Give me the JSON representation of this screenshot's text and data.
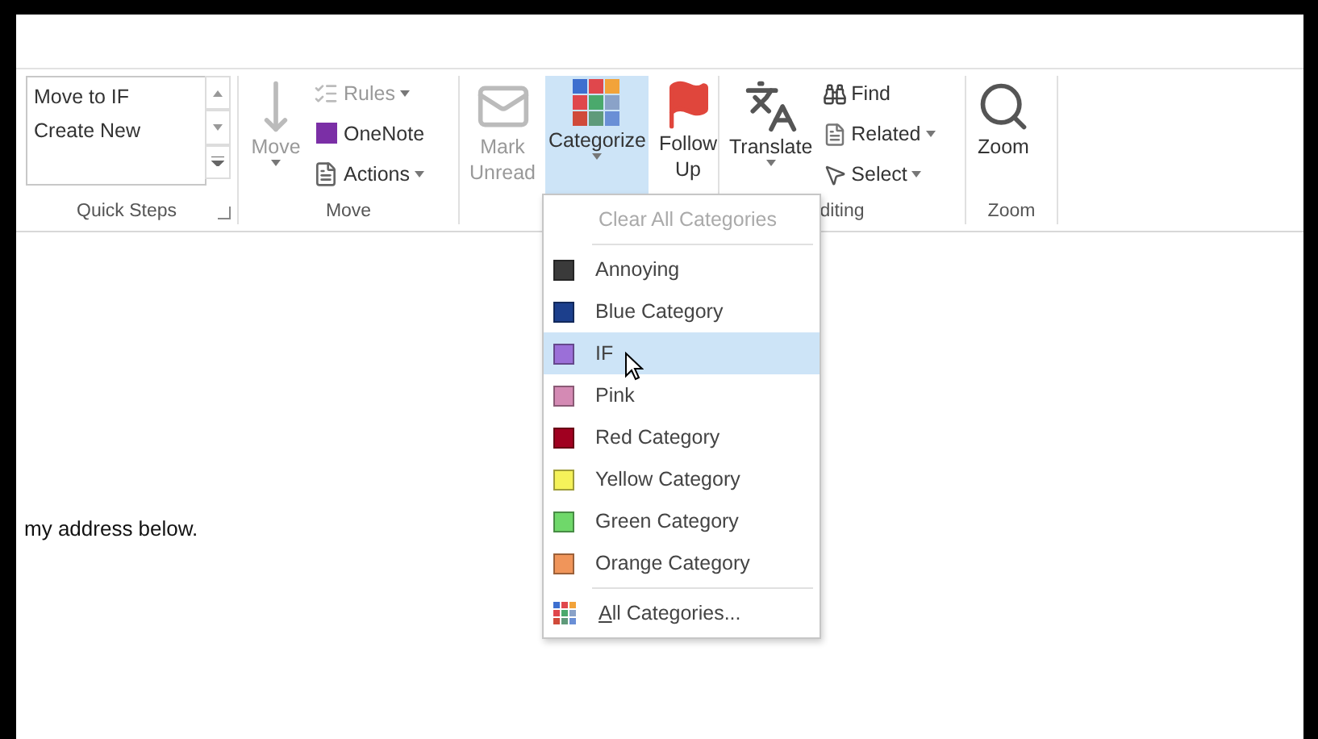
{
  "quick_steps": {
    "items": [
      "Move to IF",
      "Create New"
    ],
    "label": "Quick Steps"
  },
  "move_group": {
    "move_button": "Move",
    "rules": "Rules",
    "onenote": "OneNote",
    "actions": "Actions",
    "label": "Move"
  },
  "tags_group": {
    "mark_unread": "Mark\nUnread",
    "categorize": "Categorize",
    "categorize_selected": true,
    "follow_up": "Follow\nUp"
  },
  "editing_group": {
    "translate": "Translate",
    "find": "Find",
    "related": "Related",
    "select": "Select",
    "label": "diting"
  },
  "zoom_group": {
    "zoom": "Zoom",
    "label": "Zoom"
  },
  "body_text": "my address below.",
  "category_menu": {
    "clear": {
      "label": "Clear All Categories",
      "disabled": true
    },
    "items": [
      {
        "label": "Annoying",
        "color": "#3a3a3a",
        "selected": false
      },
      {
        "label": "Blue Category",
        "color": "#1c3f8c",
        "selected": false
      },
      {
        "label": "IF",
        "color": "#9b6fd8",
        "selected": true
      },
      {
        "label": "Pink",
        "color": "#d48ab4",
        "selected": false
      },
      {
        "label": "Red Category",
        "color": "#a00020",
        "selected": false
      },
      {
        "label": "Yellow Category",
        "color": "#f5f25a",
        "selected": false
      },
      {
        "label": "Green Category",
        "color": "#6fd86a",
        "selected": false
      },
      {
        "label": "Orange Category",
        "color": "#f0955a",
        "selected": false
      }
    ],
    "all": "All Categories..."
  }
}
